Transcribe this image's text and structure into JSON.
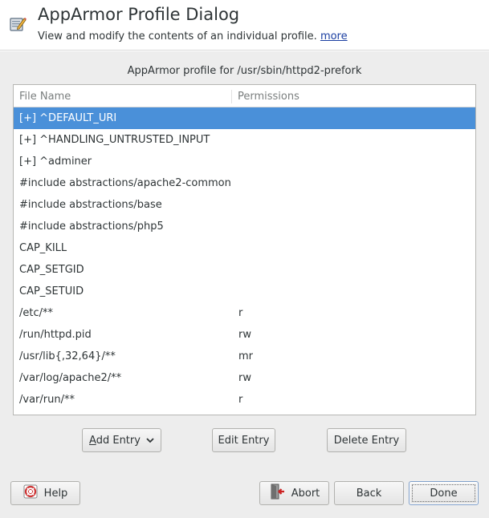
{
  "header": {
    "title": "AppArmor Profile Dialog",
    "description": "View and modify the contents of an individual profile.",
    "more_link": "more"
  },
  "profile_label": "AppArmor profile for /usr/sbin/httpd2-prefork",
  "table": {
    "columns": [
      "File Name",
      "Permissions"
    ],
    "rows": [
      {
        "name": "[+] ^DEFAULT_URI",
        "perm": "",
        "selected": true
      },
      {
        "name": "[+] ^HANDLING_UNTRUSTED_INPUT",
        "perm": ""
      },
      {
        "name": "[+] ^adminer",
        "perm": ""
      },
      {
        "name": "#include abstractions/apache2-common",
        "perm": ""
      },
      {
        "name": "#include abstractions/base",
        "perm": ""
      },
      {
        "name": "#include abstractions/php5",
        "perm": ""
      },
      {
        "name": "CAP_KILL",
        "perm": ""
      },
      {
        "name": "CAP_SETGID",
        "perm": ""
      },
      {
        "name": "CAP_SETUID",
        "perm": ""
      },
      {
        "name": "/etc/**",
        "perm": "r"
      },
      {
        "name": "/run/httpd.pid",
        "perm": "rw"
      },
      {
        "name": "/usr/lib{,32,64}/**",
        "perm": "mr"
      },
      {
        "name": "/var/log/apache2/**",
        "perm": "rw"
      },
      {
        "name": "/var/run/**",
        "perm": "r"
      }
    ]
  },
  "actions": {
    "add_entry": "Add Entry",
    "edit_entry": "Edit Entry",
    "delete_entry": "Delete Entry"
  },
  "footer": {
    "help": "Help",
    "abort": "Abort",
    "back": "Back",
    "done": "Done"
  },
  "icons": {
    "header": "document-edit-icon",
    "help": "lifebuoy-help-icon",
    "abort": "exit-door-icon",
    "dropdown": "chevron-down-icon"
  },
  "colors": {
    "selection": "#4a90d9",
    "link": "#1a3ea1",
    "body_bg": "#ededed"
  }
}
